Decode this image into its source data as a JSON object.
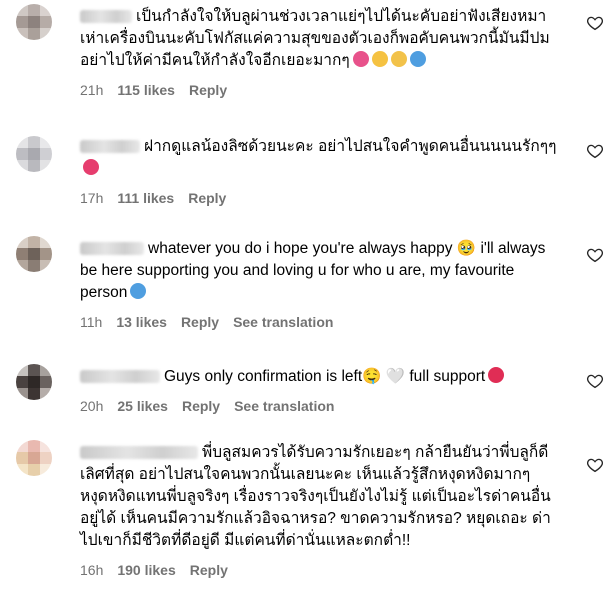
{
  "comments": [
    {
      "text": "เป็นกำลังใจให้บลูผ่านช่วงเวลาแย่ๆไปได้นะคับอย่าฟังเสียงหมาเห่าเครื่องบินนะคับโฟกัสแค่ความสุขของตัวเองก็พอคับคนพวกนี้มันมีปมอย่าไปให้ค่ามีคนให้กำลังใจอีกเยอะมากๆ",
      "emojis": [
        "heart-eyes-emoji",
        "smiling-emoji",
        "yellow-heart-emoji",
        "blue-heart-emoji"
      ],
      "time": "21h",
      "likes": "115 likes",
      "reply": "Reply"
    },
    {
      "text": "ฝากดูแลน้องลิซด้วยนะคะ อย่าไปสนใจคำพูดคนอื่นนนนนรักๆๆ",
      "emojis": [
        "pink-heart-emoji"
      ],
      "time": "17h",
      "likes": "111 likes",
      "reply": "Reply"
    },
    {
      "text": "whatever you do i hope you're always happy 🥹 i'll always be here supporting you and loving u for who u are, my favourite person",
      "emojis": [
        "blue-heart-emoji"
      ],
      "time": "11h",
      "likes": "13 likes",
      "reply": "Reply",
      "translate": "See translation"
    },
    {
      "text": "Guys only confirmation is left🤤 🤍 full support",
      "emojis": [
        "red-heart-emoji"
      ],
      "time": "20h",
      "likes": "25 likes",
      "reply": "Reply",
      "translate": "See translation"
    },
    {
      "text": "พี่บลูสมควรได้รับความรักเยอะๆ กล้ายืนยันว่าพี่บลูก็ดีเลิศที่สุด อย่าไปสนใจคนพวกนั้นเลยนะคะ เห็นแล้วรู้สึกหงุดหงิดมากๆ หงุดหงิดแทนพี่บลูจริงๆ เรื่องราวจริงๆเป็นยังไงไม่รู้ แต่เป็นอะไรด่าคนอื่นอยู่ได้ เห็นคนมีความรักแล้วอิจฉาหรอ? ขาดความรักหรอ? หยุดเถอะ ด่าไปเขาก็มีชีวิตที่ดีอยู่ดี มีแต่คนที่ด่านั่นแหละตกต่ำ!!",
      "emojis": [],
      "time": "16h",
      "likes": "190 likes",
      "reply": "Reply"
    }
  ],
  "colors": {
    "meta_gray": "#737373",
    "heart_outline": "#262626"
  },
  "icons": {
    "like": "heart-outline-icon"
  }
}
